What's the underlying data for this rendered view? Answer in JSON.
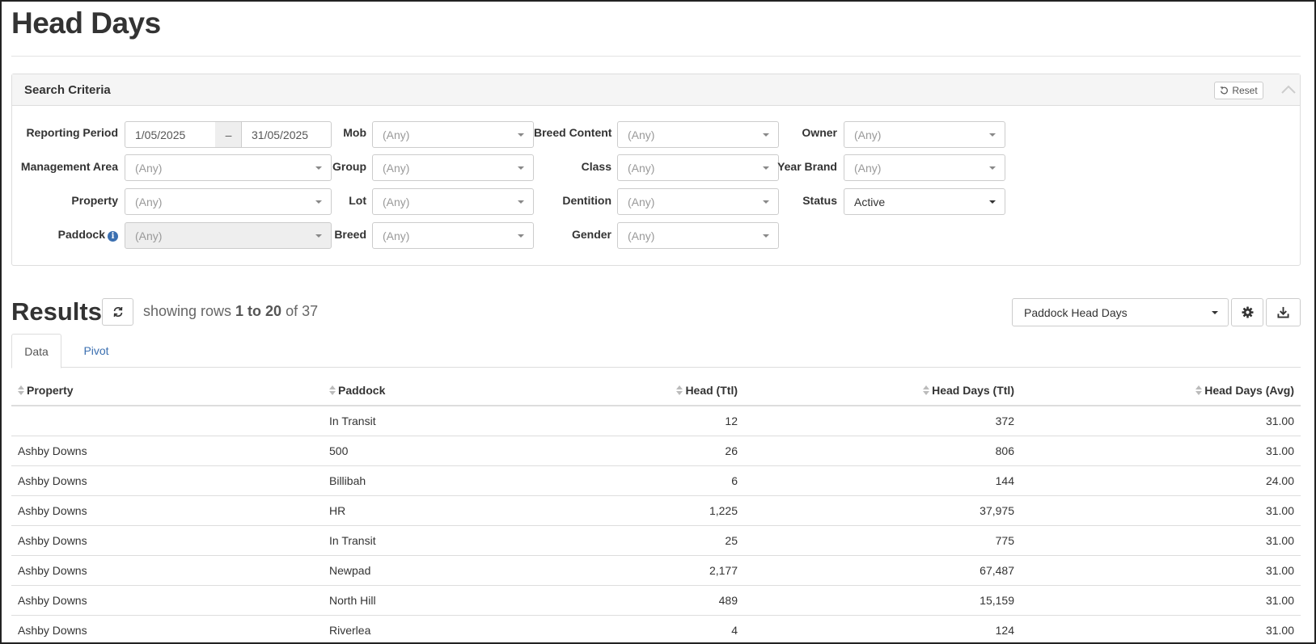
{
  "page": {
    "title": "Head Days"
  },
  "search": {
    "title": "Search Criteria",
    "reset_label": "Reset",
    "reporting_period": {
      "label": "Reporting Period",
      "from": "1/05/2025",
      "separator": "–",
      "to": "31/05/2025"
    },
    "fields": {
      "management_area": {
        "label": "Management Area",
        "value": "(Any)"
      },
      "property": {
        "label": "Property",
        "value": "(Any)"
      },
      "paddock": {
        "label": "Paddock",
        "value": "(Any)",
        "info_icon": "i"
      },
      "mob": {
        "label": "Mob",
        "value": "(Any)"
      },
      "group": {
        "label": "Group",
        "value": "(Any)"
      },
      "lot": {
        "label": "Lot",
        "value": "(Any)"
      },
      "breed": {
        "label": "Breed",
        "value": "(Any)"
      },
      "breed_content": {
        "label": "Breed Content",
        "value": "(Any)"
      },
      "class": {
        "label": "Class",
        "value": "(Any)"
      },
      "dentition": {
        "label": "Dentition",
        "value": "(Any)"
      },
      "gender": {
        "label": "Gender",
        "value": "(Any)"
      },
      "owner": {
        "label": "Owner",
        "value": "(Any)"
      },
      "year_brand": {
        "label": "Year Brand",
        "value": "(Any)"
      },
      "status": {
        "label": "Status",
        "value": "Active"
      }
    }
  },
  "results": {
    "title": "Results",
    "showing_prefix": "showing rows ",
    "showing_range": "1 to 20",
    "showing_mid": " of ",
    "showing_total": "37",
    "view_select": "Paddock Head Days",
    "tabs": [
      {
        "label": "Data"
      },
      {
        "label": "Pivot"
      }
    ],
    "columns": [
      "Property",
      "Paddock",
      "Head (Ttl)",
      "Head Days (Ttl)",
      "Head Days (Avg)"
    ],
    "rows": [
      {
        "property": "",
        "paddock": "In Transit",
        "head": "12",
        "head_days": "372",
        "avg": "31.00"
      },
      {
        "property": "Ashby Downs",
        "paddock": "500",
        "head": "26",
        "head_days": "806",
        "avg": "31.00"
      },
      {
        "property": "Ashby Downs",
        "paddock": "Billibah",
        "head": "6",
        "head_days": "144",
        "avg": "24.00"
      },
      {
        "property": "Ashby Downs",
        "paddock": "HR",
        "head": "1,225",
        "head_days": "37,975",
        "avg": "31.00"
      },
      {
        "property": "Ashby Downs",
        "paddock": "In Transit",
        "head": "25",
        "head_days": "775",
        "avg": "31.00"
      },
      {
        "property": "Ashby Downs",
        "paddock": "Newpad",
        "head": "2,177",
        "head_days": "67,487",
        "avg": "31.00"
      },
      {
        "property": "Ashby Downs",
        "paddock": "North Hill",
        "head": "489",
        "head_days": "15,159",
        "avg": "31.00"
      },
      {
        "property": "Ashby Downs",
        "paddock": "Riverlea",
        "head": "4",
        "head_days": "124",
        "avg": "31.00"
      }
    ]
  },
  "icons": {
    "reset": "undo-icon",
    "collapse": "chevron-up-icon",
    "refresh": "refresh-icon",
    "settings": "gear-icon",
    "download": "download-icon",
    "info": "info-icon",
    "sort": "sort-icon"
  },
  "colors": {
    "link": "#3b6fb0",
    "border": "#dddddd",
    "panel_header": "#f5f5f5"
  }
}
